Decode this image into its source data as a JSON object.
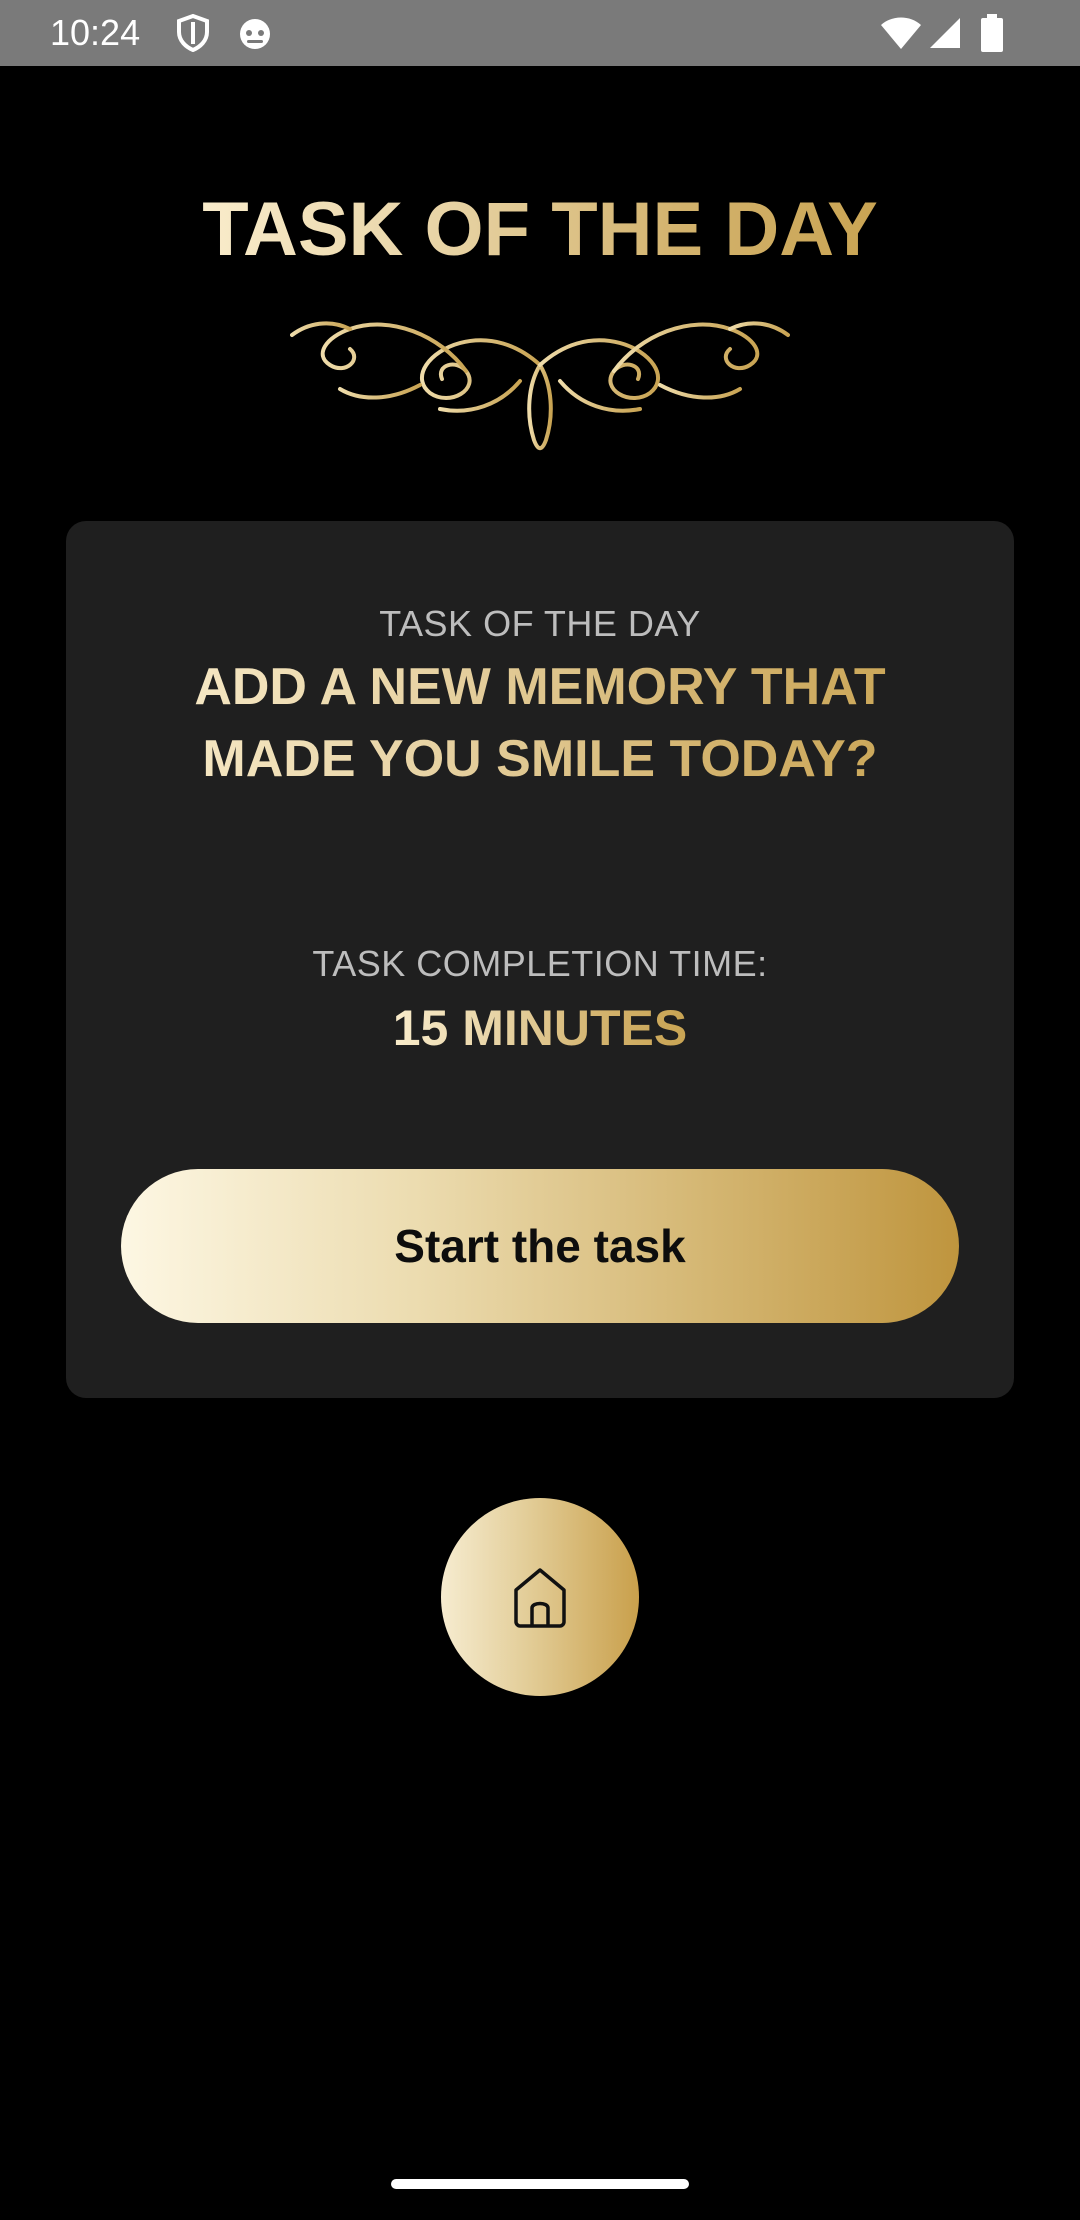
{
  "status_bar": {
    "time": "10:24",
    "left_icons": [
      "shield-icon",
      "cat-face-icon"
    ],
    "right_icons": [
      "wifi-icon",
      "signal-icon",
      "battery-icon"
    ]
  },
  "header": {
    "title": "TASK OF THE DAY",
    "ornament_icon": "flourish-ornament-icon"
  },
  "task_card": {
    "kicker": "TASK OF THE DAY",
    "question": "ADD A NEW MEMORY THAT MADE YOU SMILE TODAY?",
    "completion_label": "TASK COMPLETION TIME:",
    "completion_value": "15 MINUTES",
    "start_button_label": "Start the task"
  },
  "bottom_nav": {
    "home_icon": "home-icon"
  },
  "colors": {
    "background": "#000000",
    "card": "#1f1f1f",
    "gold_light": "#f9eccb",
    "gold_dark": "#c9a453",
    "muted_text": "#bdbdbd"
  }
}
